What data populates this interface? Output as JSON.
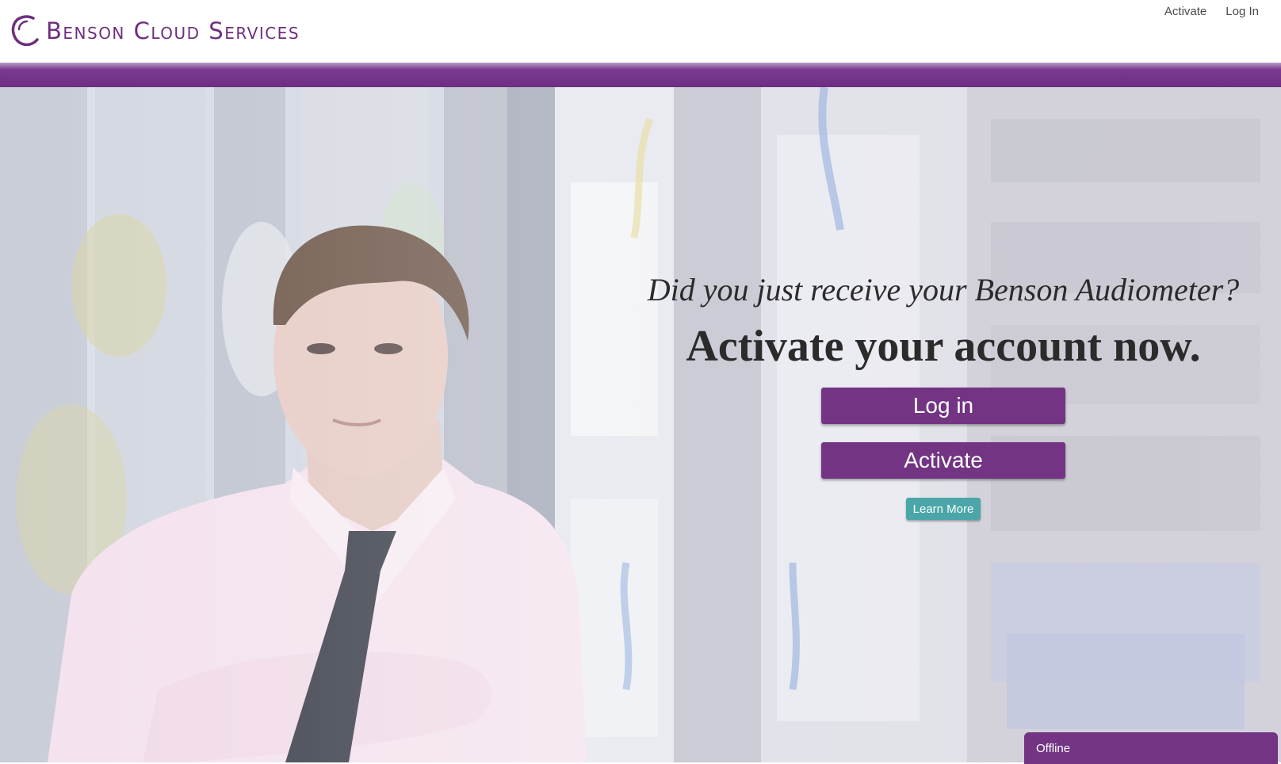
{
  "header": {
    "logo_text": "Benson Cloud Services",
    "nav": {
      "activate": "Activate",
      "login": "Log In"
    }
  },
  "hero": {
    "subheading": "Did you just receive your Benson Audiometer?",
    "heading": "Activate your account now.",
    "login_button": "Log in",
    "activate_button": "Activate",
    "learn_more_button": "Learn More"
  },
  "chat_widget": {
    "status": "Offline"
  },
  "colors": {
    "brand_purple": "#723483",
    "learn_more_teal": "#4aa6a9"
  },
  "icons": [
    "logo-arc-icon"
  ]
}
